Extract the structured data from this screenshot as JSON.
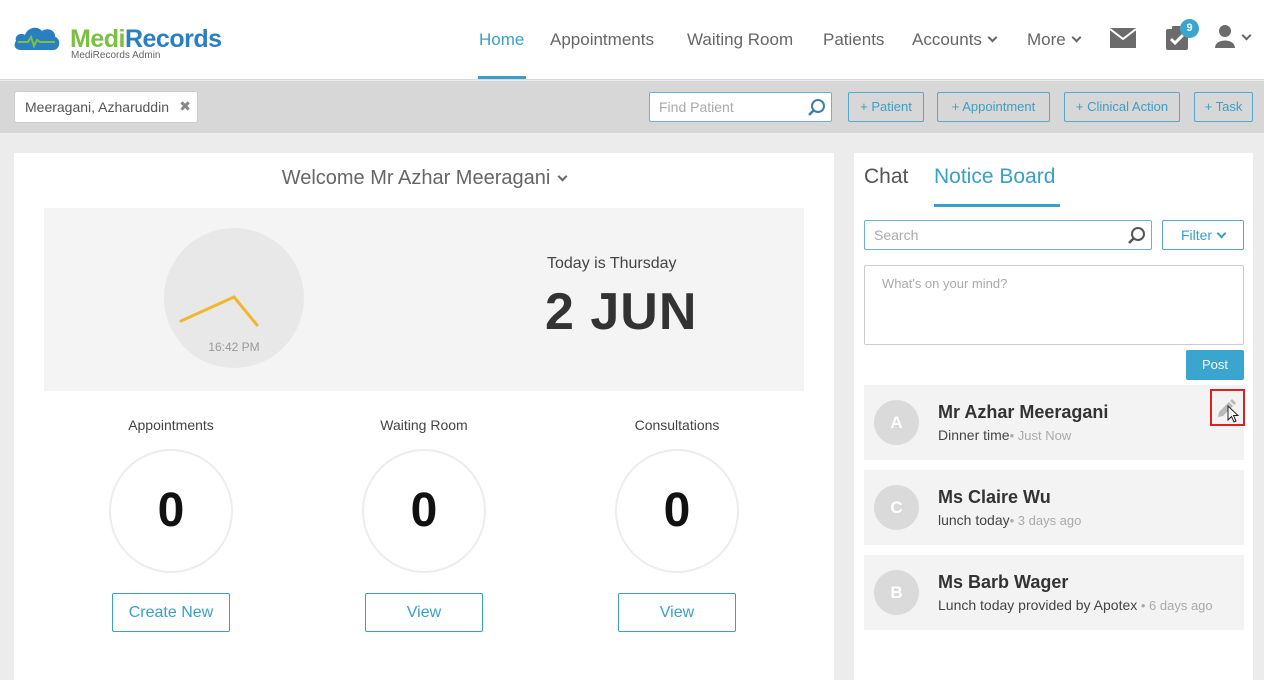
{
  "app": {
    "brand_first": "Medi",
    "brand_second": "Records",
    "brand_sub": "MediRecords Admin"
  },
  "nav": {
    "home": "Home",
    "appointments": "Appointments",
    "waiting_room": "Waiting Room",
    "patients": "Patients",
    "accounts": "Accounts",
    "more": "More",
    "tasks_badge": "9",
    "icons": [
      "mail-icon",
      "tasks-icon",
      "user-icon"
    ]
  },
  "toolbar": {
    "open_patient": "Meeragani, Azharuddin",
    "close_glyph": "✖",
    "find_placeholder": "Find Patient",
    "add_patient": "+ Patient",
    "add_appointment": "+ Appointment",
    "add_clinical_action": "+ Clinical Action",
    "add_task": "+ Task"
  },
  "dashboard": {
    "welcome": "Welcome Mr Azhar Meeragani",
    "clock_time": "16:42 PM",
    "today_label": "Today is Thursday",
    "date": "2 JUN",
    "stats": [
      {
        "label": "Appointments",
        "value": "0",
        "button": "Create New"
      },
      {
        "label": "Waiting Room",
        "value": "0",
        "button": "View"
      },
      {
        "label": "Consultations",
        "value": "0",
        "button": "View"
      }
    ]
  },
  "sidebar": {
    "tab_chat": "Chat",
    "tab_notice_board": "Notice Board",
    "search_placeholder": "Search",
    "filter_label": "Filter",
    "mind_placeholder": "What's on your mind?",
    "post_label": "Post",
    "notices": [
      {
        "initial": "A",
        "name": "Mr Azhar Meeragani",
        "message": "Dinner time",
        "when": "• Just Now"
      },
      {
        "initial": "C",
        "name": "Ms Claire Wu",
        "message": "lunch today",
        "when": "• 3 days ago"
      },
      {
        "initial": "B",
        "name": "Ms Barb Wager",
        "message": "Lunch today provided by Apotex",
        "when": " • 6 days ago"
      }
    ]
  },
  "colors": {
    "accent": "#3a9fc8",
    "brand_green": "#7bc043",
    "brand_blue": "#2a7fc1",
    "clock_hand": "#f0b72c",
    "highlight": "#e02020"
  }
}
